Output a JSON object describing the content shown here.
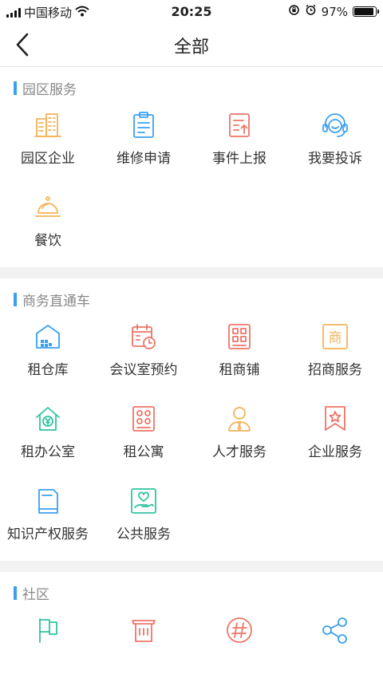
{
  "status_bar": {
    "carrier": "中国移动",
    "time": "20:25",
    "battery_text": "97%",
    "battery_level": 0.97
  },
  "header": {
    "title": "全部"
  },
  "sections": [
    {
      "title": "园区服务",
      "items": [
        {
          "label": "园区企业",
          "icon": "building-icon",
          "color": "#f5b35a"
        },
        {
          "label": "维修申请",
          "icon": "clipboard-icon",
          "color": "#3aa0f0"
        },
        {
          "label": "事件上报",
          "icon": "report-upload-icon",
          "color": "#ee7468"
        },
        {
          "label": "我要投诉",
          "icon": "headset-icon",
          "color": "#3aa0f0"
        },
        {
          "label": "餐饮",
          "icon": "food-cloche-icon",
          "color": "#f5b35a"
        }
      ]
    },
    {
      "title": "商务直通车",
      "items": [
        {
          "label": "租仓库",
          "icon": "warehouse-icon",
          "color": "#3aa0f0"
        },
        {
          "label": "会议室预约",
          "icon": "calendar-clock-icon",
          "color": "#ee7468"
        },
        {
          "label": "租商铺",
          "icon": "shop-grid-icon",
          "color": "#ee7468"
        },
        {
          "label": "招商服务",
          "icon": "merchant-sign-icon",
          "color": "#f5b35a"
        },
        {
          "label": "租办公室",
          "icon": "house-yen-icon",
          "color": "#2ec4a0"
        },
        {
          "label": "租公寓",
          "icon": "apartment-icon",
          "color": "#ee7468"
        },
        {
          "label": "人才服务",
          "icon": "person-tie-icon",
          "color": "#f5b35a"
        },
        {
          "label": "企业服务",
          "icon": "bookmark-star-icon",
          "color": "#ee7468"
        },
        {
          "label": "知识产权服务",
          "icon": "document-icon",
          "color": "#3aa0f0"
        },
        {
          "label": "公共服务",
          "icon": "heart-hand-icon",
          "color": "#2ec4a0"
        }
      ]
    },
    {
      "title": "社区",
      "items": [
        {
          "label": "",
          "icon": "flag-icon",
          "color": "#2ec4a0"
        },
        {
          "label": "",
          "icon": "store-icon",
          "color": "#ee7468"
        },
        {
          "label": "",
          "icon": "hashtag-icon",
          "color": "#ee7468"
        },
        {
          "label": "",
          "icon": "share-icon",
          "color": "#3aa0f0"
        }
      ]
    }
  ]
}
